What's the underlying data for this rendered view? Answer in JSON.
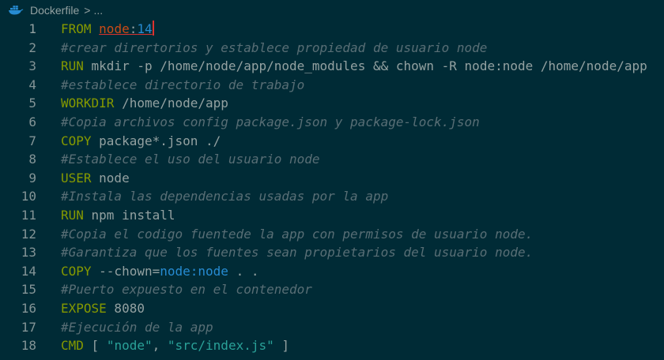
{
  "breadcrumb": {
    "file_name": "Dockerfile",
    "separator": ">",
    "ellipsis": "..."
  },
  "lines": [
    {
      "num": "1",
      "tokens": [
        {
          "t": "FROM",
          "c": "kw"
        },
        {
          "t": " ",
          "c": "pl"
        },
        {
          "t": "node",
          "c": "img"
        },
        {
          "t": ":",
          "c": "pl"
        },
        {
          "t": "14",
          "c": "var"
        }
      ]
    },
    {
      "num": "2",
      "tokens": [
        {
          "t": "#crear dirertorios y establece propiedad de usuario node",
          "c": "cm"
        }
      ]
    },
    {
      "num": "3",
      "tokens": [
        {
          "t": "RUN",
          "c": "kw"
        },
        {
          "t": " mkdir -p /home/node/app/node_modules && chown -R node:node /home/node/app",
          "c": "pl"
        }
      ]
    },
    {
      "num": "4",
      "tokens": [
        {
          "t": "#establece directorio de trabajo",
          "c": "cm"
        }
      ]
    },
    {
      "num": "5",
      "tokens": [
        {
          "t": "WORKDIR",
          "c": "kw"
        },
        {
          "t": " /home/node/app",
          "c": "pl"
        }
      ]
    },
    {
      "num": "6",
      "tokens": [
        {
          "t": "#Copia archivos config package.json y package-lock.json",
          "c": "cm"
        }
      ]
    },
    {
      "num": "7",
      "tokens": [
        {
          "t": "COPY",
          "c": "kw"
        },
        {
          "t": " package*.json ./",
          "c": "pl"
        }
      ]
    },
    {
      "num": "8",
      "tokens": [
        {
          "t": "#Establece el uso del usuario node",
          "c": "cm"
        }
      ]
    },
    {
      "num": "9",
      "tokens": [
        {
          "t": "USER",
          "c": "kw"
        },
        {
          "t": " node",
          "c": "pl"
        }
      ]
    },
    {
      "num": "10",
      "tokens": [
        {
          "t": "#Instala las dependencias usadas por la app",
          "c": "cm"
        }
      ]
    },
    {
      "num": "11",
      "tokens": [
        {
          "t": "RUN",
          "c": "kw"
        },
        {
          "t": " npm install",
          "c": "pl"
        }
      ]
    },
    {
      "num": "12",
      "tokens": [
        {
          "t": "#Copia el codigo fuentede la app con permisos de usuario node.",
          "c": "cm"
        }
      ]
    },
    {
      "num": "13",
      "tokens": [
        {
          "t": "#Garantiza que los fuentes sean propietarios del usuario node.",
          "c": "cm"
        }
      ]
    },
    {
      "num": "14",
      "tokens": [
        {
          "t": "COPY",
          "c": "kw"
        },
        {
          "t": " --chown",
          "c": "pl"
        },
        {
          "t": "=",
          "c": "pl"
        },
        {
          "t": "node:node",
          "c": "var"
        },
        {
          "t": " . .",
          "c": "pl"
        }
      ]
    },
    {
      "num": "15",
      "tokens": [
        {
          "t": "#Puerto expuesto en el contenedor",
          "c": "cm"
        }
      ]
    },
    {
      "num": "16",
      "tokens": [
        {
          "t": "EXPOSE",
          "c": "kw"
        },
        {
          "t": " 8080",
          "c": "pl"
        }
      ]
    },
    {
      "num": "17",
      "tokens": [
        {
          "t": "#Ejecución de la app",
          "c": "cm"
        }
      ]
    },
    {
      "num": "18",
      "tokens": [
        {
          "t": "CMD",
          "c": "kw"
        },
        {
          "t": " [ ",
          "c": "pl"
        },
        {
          "t": "\"node\"",
          "c": "str"
        },
        {
          "t": ", ",
          "c": "pl"
        },
        {
          "t": "\"src/index.js\"",
          "c": "str"
        },
        {
          "t": " ]",
          "c": "pl"
        }
      ]
    }
  ],
  "icons": {
    "file_icon": "docker-icon"
  },
  "colors": {
    "background": "#002b36",
    "keyword": "#859900",
    "comment": "#586e75",
    "string": "#2aa198",
    "variable": "#268bd2",
    "image_name": "#cb4b16",
    "plain": "#93a1a1",
    "cursor": "#dc322f"
  }
}
